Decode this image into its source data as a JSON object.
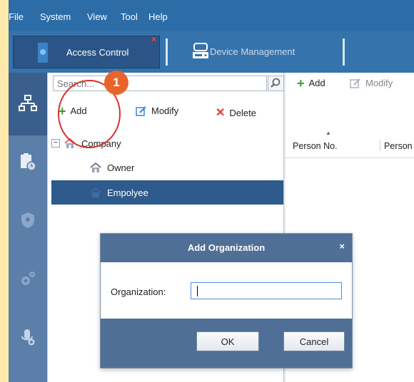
{
  "menu": {
    "items": [
      "File",
      "System",
      "View",
      "Tool",
      "Help"
    ]
  },
  "tabs": {
    "access_control": "Access Control",
    "device_management": "Device Management"
  },
  "left_toolbar": {
    "search_placeholder": "Search...",
    "add": "Add",
    "modify": "Modify",
    "delete": "Delete"
  },
  "right_toolbar": {
    "add": "Add",
    "modify": "Modify"
  },
  "tree": {
    "root": "Company",
    "children": [
      "Owner",
      "Empolyee"
    ]
  },
  "table": {
    "columns": [
      "Person No.",
      "Person"
    ]
  },
  "dialog": {
    "title": "Add Organization",
    "close": "×",
    "field_label": "Organization:",
    "field_value": "",
    "ok": "OK",
    "cancel": "Cancel"
  },
  "annotation": {
    "step": "1"
  },
  "colors": {
    "menubar": "#2c6ca7",
    "selection": "#2e5a8c",
    "dialog_header": "#4f6f96",
    "annotation": "#e9642b"
  }
}
